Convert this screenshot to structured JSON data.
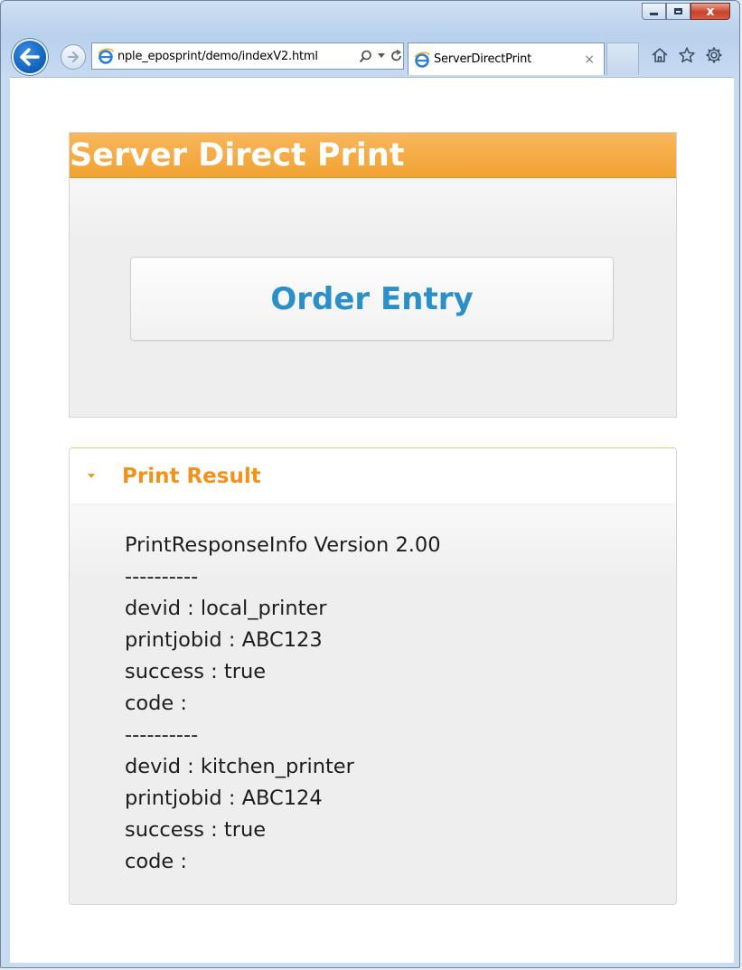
{
  "browser": {
    "address_url": "nple_eposprint/demo/indexV2.html",
    "tab_title": "ServerDirectPrint",
    "tab_close": "×",
    "window_close": "x"
  },
  "page": {
    "header_title": "Server Direct Print",
    "order_entry_label": "Order Entry",
    "print_result_title": "Print Result",
    "result_lines": [
      "PrintResponseInfo Version 2.00",
      "----------",
      "devid : local_printer",
      "printjobid : ABC123",
      "success : true",
      "code : ",
      "----------",
      "devid : kitchen_printer",
      "printjobid : ABC124",
      "success : true",
      "code : "
    ]
  },
  "colors": {
    "header_orange": "#f2a332",
    "accent_orange": "#f0921c",
    "button_text_blue": "#2b90c7"
  }
}
